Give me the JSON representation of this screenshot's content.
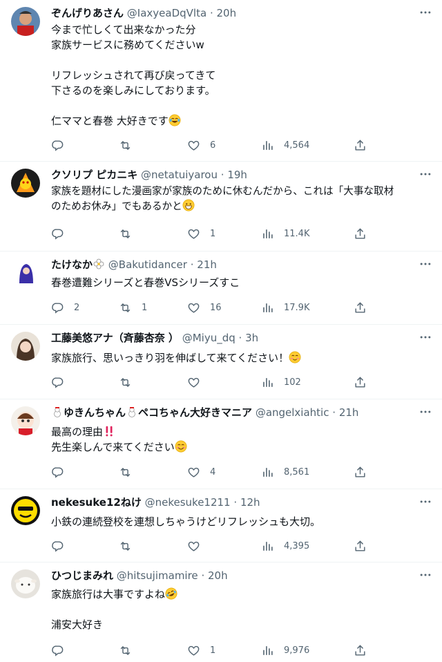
{
  "tweets": [
    {
      "display_name": "ぞんげりあさん",
      "handle": "@IaxyeaDqVlta",
      "time": "20h",
      "lines": [
        "今まで忙しくて出来なかった分",
        "家族サービスに務めてくださいw",
        "",
        "リフレッシュされて再び戻ってきて",
        "下さるのを楽しみにしております。",
        "",
        "仁ママと春巻 大好きです"
      ],
      "emoji": "laughing-tears",
      "reply_count": "",
      "retweet_count": "",
      "like_count": "6",
      "view_count": "4,564"
    },
    {
      "display_name": "クソリプ ピカニキ",
      "handle": "@netatuiyarou",
      "time": "19h",
      "lines": [
        "家族を題材にした漫画家が家族のために休むんだから、これは「大事な取材",
        "のためお休み」でもあるかと"
      ],
      "emoji": "grinning",
      "reply_count": "",
      "retweet_count": "",
      "like_count": "1",
      "view_count": "11.4K"
    },
    {
      "display_name": "たけなか",
      "handle": "@Bakutidancer",
      "time": "21h",
      "lines": [
        "春巻遭難シリーズと春巻VSシリーズすこ"
      ],
      "emoji": "",
      "reply_count": "2",
      "retweet_count": "1",
      "like_count": "16",
      "view_count": "17.9K"
    },
    {
      "display_name": "工藤美悠アナ（斉藤杏奈 ）",
      "handle": "@Miyu_dq",
      "time": "3h",
      "lines": [
        "家族旅行、思いっきり羽を伸ばして来てください！"
      ],
      "emoji": "relaxed",
      "reply_count": "",
      "retweet_count": "",
      "like_count": "",
      "view_count": "102"
    },
    {
      "display_name_parts": [
        "ゆきんちゃん",
        "ペコちゃん大好きマニア"
      ],
      "display_name": "ゆきんちゃん ペコちゃん大好きマニア",
      "handle": "@angelxiahtic",
      "time": "21h",
      "lines": [
        "最高の理由",
        "先生楽しんで来てください"
      ],
      "emoji": "smiling",
      "reply_count": "",
      "retweet_count": "",
      "like_count": "4",
      "view_count": "8,561"
    },
    {
      "display_name": "nekesuke12ねけ",
      "handle": "@nekesuke1211",
      "time": "12h",
      "lines": [
        "小鉄の連続登校を連想しちゃうけどリフレッシュも大切。"
      ],
      "emoji": "",
      "reply_count": "",
      "retweet_count": "",
      "like_count": "",
      "view_count": "4,395"
    },
    {
      "display_name": "ひつじまみれ",
      "handle": "@hitsujimamire",
      "time": "20h",
      "lines": [
        "家族旅行は大事ですよね",
        "",
        "浦安大好き"
      ],
      "emoji": "rolling-laughing",
      "reply_count": "",
      "retweet_count": "",
      "like_count": "1",
      "view_count": "9,976"
    }
  ],
  "separator": "·",
  "colors": {
    "text": "#0f1419",
    "muted": "#536471",
    "border": "#eff3f4"
  }
}
